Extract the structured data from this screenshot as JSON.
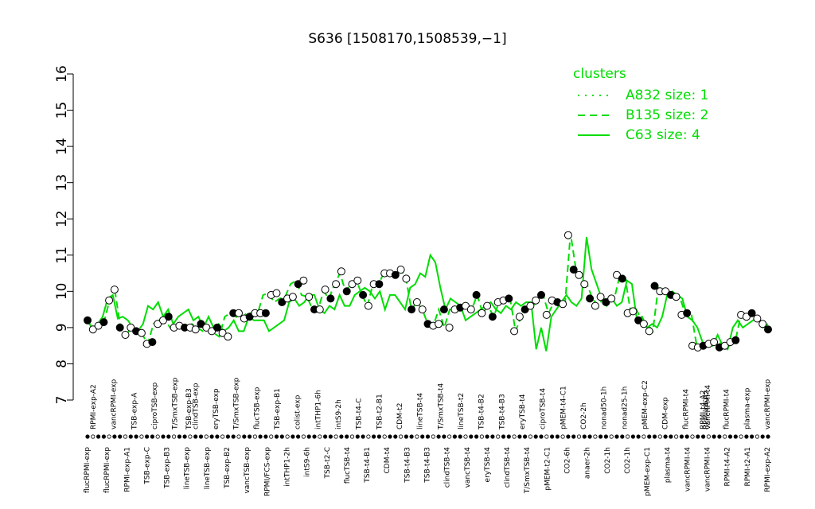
{
  "chart_data": {
    "type": "line",
    "title": "S636 [1508170,1508539,−1]",
    "xlabel": "",
    "ylabel": "",
    "ylim": [
      7,
      16
    ],
    "yticks": [
      7,
      8,
      9,
      10,
      11,
      12,
      13,
      14,
      15,
      16
    ],
    "grid": false,
    "legend": {
      "title": "clusters",
      "placement": "top-right",
      "entries": [
        {
          "label": "A832 size: 1",
          "style": "dotted"
        },
        {
          "label": "B135 size: 2",
          "style": "dashed"
        },
        {
          "label": "C63 size: 4",
          "style": "solid"
        }
      ]
    },
    "colors": {
      "series": "#00dd00",
      "points": "#000000",
      "background": "#ffffff"
    },
    "x_labels_top": [
      "RPMI-exp-A2",
      "vancRPMI-exp",
      "TSB-exp-A",
      "ciproTSB-exp",
      "T/SmxTSB-exp",
      "clindTSB-exp",
      "eryTSB-exp",
      "T/SmxTSB-exp",
      "flucTSB-exp",
      "TSB-exp-B1",
      "colist-exp",
      "intTHP1-6h",
      "intS9-2h",
      "TSB-t4-C",
      "TSB-t2-B1",
      "CDM-t2",
      "lineTSB-t4",
      "T/SmxTSB-t4",
      "lineTSB-t2",
      "TSB-t4-B2",
      "TSB-t4-B3",
      "eryTSB-t4",
      "ciproTSB-t4",
      "pMEM-t4-C1",
      "CO2-2h",
      "nonad50-1h",
      "nonad25-1h",
      "pMEM-exp-C2",
      "CDM-exp",
      "flucRPMI-t4",
      "RPMI-t4-A2",
      "flucRPMI-t4",
      "plasma-exp",
      "vancRPMI-exp"
    ],
    "x_labels_bottom": [
      "flucRPMI-exp",
      "flucRPMI-exp",
      "RPMI-exp-A1",
      "TSB-exp-C",
      "TSB-exp-B3",
      "lineTSB-exp",
      "lineTSB-exp",
      "TSB-exp-B2",
      "vancTSB-exp",
      "RPMI/FCS-exp",
      "intTHP1-2h",
      "intS9-6h",
      "TSB-t2-C",
      "flucTSB-t4",
      "TSB-t4-B1",
      "CDM-t4",
      "TSB-t4-B3",
      "TSB-t4-B3",
      "clindTSB-t4",
      "vancTSB-t4",
      "eryTSB-t4",
      "clindTSB-t4",
      "T/SmxTSB-t4",
      "pMEM-t2-C1",
      "CO2-6h",
      "anaer-2h",
      "CO2-1h",
      "CO2-1h",
      "pMEM-exp-C1",
      "plasma-t4",
      "vancRPMI-t4",
      "vancRPMI-t4",
      "RPMI-t4-A2",
      "RPMI-t2-A1",
      "RPMI-exp-A2"
    ],
    "x_overlap_labels": [
      "TSB-exp-B3",
      "RPMI-t4-A2",
      "vancRPMI-t4"
    ],
    "series": [
      {
        "name": "C63 size: 4",
        "style": "solid",
        "values": [
          9.15,
          9.0,
          9.1,
          9.3,
          9.8,
          9.9,
          9.25,
          9.3,
          9.2,
          9.0,
          8.9,
          9.1,
          9.6,
          9.5,
          9.7,
          9.3,
          9.5,
          9.1,
          9.3,
          9.4,
          9.5,
          9.2,
          9.3,
          9.0,
          9.3,
          9.0,
          9.1,
          8.9,
          9.0,
          9.2,
          8.9,
          8.9,
          9.3,
          9.2,
          9.2,
          9.2,
          8.9,
          9.0,
          9.1,
          9.2,
          9.7,
          9.8,
          9.6,
          9.7,
          9.9,
          9.9,
          9.5,
          9.4,
          9.6,
          9.5,
          9.9,
          9.6,
          9.6,
          9.9,
          10.0,
          10.1,
          10.0,
          9.8,
          10.0,
          9.5,
          9.9,
          9.9,
          9.7,
          9.5,
          10.1,
          10.2,
          10.5,
          10.4,
          11.0,
          10.8,
          10.1,
          9.5,
          9.8,
          9.7,
          9.6,
          9.2,
          9.3,
          9.4,
          9.5,
          9.6,
          9.7,
          9.5,
          9.4,
          9.6,
          9.5,
          9.7,
          9.6,
          9.7,
          9.7,
          8.4,
          9.0,
          8.35,
          9.3,
          9.5,
          9.7,
          9.9,
          9.7,
          9.6,
          9.8,
          11.5,
          10.6,
          10.2,
          9.8,
          9.6,
          9.8,
          9.6,
          9.7,
          10.3,
          10.2,
          9.2,
          9.3,
          9.0,
          9.1,
          9.0,
          9.3,
          9.9,
          10.0,
          9.9,
          9.8,
          9.3,
          9.2,
          9.0,
          8.6,
          8.5,
          8.5,
          8.8,
          8.5,
          8.4,
          9.0,
          9.2,
          9.0,
          9.1,
          9.2,
          9.3,
          9.0,
          9.1
        ]
      },
      {
        "name": "B135 size: 2",
        "style": "dashed",
        "values": [
          9.2,
          8.95,
          9.05,
          9.15,
          9.75,
          10.0,
          9.0,
          8.8,
          9.0,
          8.9,
          8.8,
          8.55,
          9.1,
          9.2,
          9.3,
          9.0,
          9.05,
          9.0,
          9.0,
          9.1,
          9.0,
          8.9,
          9.0,
          8.85,
          8.75,
          9.3,
          9.4,
          9.3,
          9.25,
          9.4,
          9.4,
          9.4,
          9.9,
          9.95,
          9.7,
          9.8,
          9.85,
          10.2,
          10.3,
          9.9,
          9.85,
          9.5,
          9.5,
          10.0,
          9.8,
          10.2,
          10.5,
          10.0,
          10.2,
          10.3,
          9.9,
          9.6,
          10.2,
          10.2,
          10.5,
          10.5,
          10.5,
          10.6,
          10.4,
          9.5,
          9.7,
          9.5,
          9.1,
          9.05,
          9.5,
          9.0,
          9.5,
          9.5,
          9.6,
          9.6,
          9.5,
          9.9,
          9.4,
          9.6,
          9.3,
          9.7,
          9.7,
          9.8,
          8.9,
          9.3,
          9.5,
          9.6,
          9.7,
          9.9,
          9.4,
          9.7,
          9.7,
          9.65,
          11.6,
          10.6,
          10.4,
          10.2,
          9.8,
          9.6,
          9.8,
          9.7,
          9.8,
          10.45,
          10.35,
          9.4,
          9.5,
          9.2,
          9.1,
          8.9,
          10.1,
          10.0,
          10.0,
          9.9,
          9.8,
          9.35,
          9.4,
          8.5,
          8.45,
          8.5,
          8.55,
          8.6,
          8.45,
          8.5,
          8.6,
          9.3,
          9.3,
          9.4,
          9.25,
          9.1,
          8.95
        ]
      }
    ],
    "points": [
      9.2,
      8.95,
      9.05,
      9.15,
      9.75,
      10.05,
      9.0,
      8.8,
      9.0,
      8.9,
      8.85,
      8.55,
      8.6,
      9.1,
      9.2,
      9.3,
      9.0,
      9.05,
      9.0,
      9.0,
      8.95,
      9.1,
      9.0,
      8.9,
      9.0,
      8.85,
      8.75,
      9.4,
      9.4,
      9.25,
      9.3,
      9.4,
      9.4,
      9.4,
      9.9,
      9.95,
      9.7,
      9.8,
      9.85,
      10.2,
      10.3,
      9.85,
      9.5,
      9.5,
      10.05,
      9.8,
      10.2,
      10.55,
      10.0,
      10.2,
      10.3,
      9.9,
      9.6,
      10.2,
      10.2,
      10.5,
      10.5,
      10.45,
      10.6,
      10.35,
      9.5,
      9.7,
      9.5,
      9.1,
      9.05,
      9.1,
      9.5,
      9.0,
      9.5,
      9.55,
      9.6,
      9.5,
      9.9,
      9.4,
      9.6,
      9.3,
      9.7,
      9.75,
      9.8,
      8.9,
      9.3,
      9.5,
      9.6,
      9.75,
      9.9,
      9.35,
      9.75,
      9.7,
      9.65,
      11.55,
      10.6,
      10.45,
      10.2,
      9.8,
      9.6,
      9.85,
      9.7,
      9.8,
      10.45,
      10.35,
      9.4,
      9.45,
      9.2,
      9.1,
      8.9,
      10.15,
      10.0,
      10.0,
      9.9,
      9.85,
      9.35,
      9.4,
      8.5,
      8.45,
      8.5,
      8.55,
      8.6,
      8.45,
      8.5,
      8.6,
      8.65,
      9.35,
      9.3,
      9.4,
      9.25,
      9.1,
      8.95
    ]
  }
}
